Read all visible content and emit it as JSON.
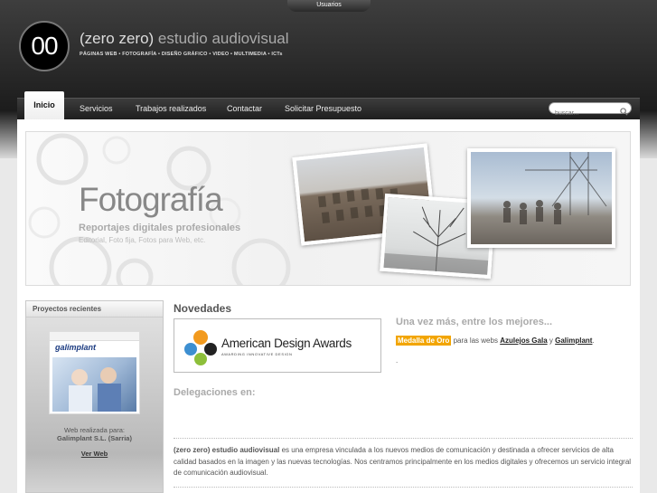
{
  "header": {
    "user_tab": "Usuarios",
    "logo_mark": "00",
    "brand_name": "(zero zero)",
    "brand_suffix": "estudio audiovisual",
    "tagline": "PÁGINAS WEB • FOTOGRAFÍA • DISEÑO GRÁFICO • VIDEO • MULTIMEDIA • ICTs"
  },
  "nav": {
    "items": [
      "Inicio",
      "Servicios",
      "Trabajos realizados",
      "Contactar",
      "Solicitar Presupuesto"
    ],
    "active": "Inicio"
  },
  "search": {
    "placeholder": "buscar..."
  },
  "banner": {
    "title": "Fotografía",
    "subtitle": "Reportajes digitales profesionales",
    "subtitle2": "Editorial, Foto fija, Fotos para Web, etc."
  },
  "sidebar": {
    "title": "Proyectos recientes",
    "thumb_brand": "galimplant",
    "caption_line1": "Web realizada para:",
    "caption_line2": "Galimplant S.L. (Sarria)",
    "link": "Ver Web"
  },
  "novedades": {
    "title": "Novedades",
    "award_name": "American Design Awards",
    "award_tagline": "AWARDING INNOVATIVE DESIGN",
    "headline": "Una vez más, entre los mejores...",
    "medal": "Medalla de Oro",
    "text_mid": "para las webs",
    "link1": "Azulejos Gala",
    "conj": "y",
    "link2": "Galimplant",
    "dot": "."
  },
  "delegaciones": {
    "title": "Delegaciones en:"
  },
  "about": {
    "bold": "(zero zero) estudio audiovisual",
    "text": "es una empresa vinculada a los nuevos medios de comunicación y destinada a ofrecer servicios de alta calidad basados en la imagen y las nuevas tecnologías. Nos centramos principalmente en los medios digitales y ofrecemos un servicio integral de comunicación audiovisual."
  },
  "colors": {
    "medal": "#f2a500",
    "nav_bg": "#2a2a2a",
    "header_bg": "#2b2b2b"
  }
}
